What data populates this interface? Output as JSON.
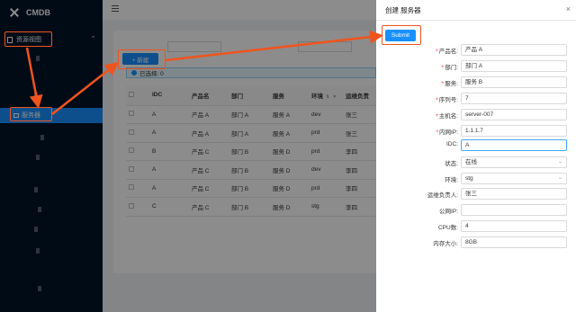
{
  "app": {
    "title": "CMDB"
  },
  "sidebar": {
    "group_label": "资源视图",
    "group_chevron": "^",
    "active_item": "服务器"
  },
  "toolbar": {
    "new_label": "+ 新建"
  },
  "selection": {
    "text": "已选择: 0"
  },
  "table": {
    "headers": [
      "IDC",
      "产品名",
      "部门",
      "服务",
      "环境",
      "运维负责"
    ],
    "rows": [
      [
        "A",
        "产品 A",
        "部门 A",
        "服务 A",
        "dev",
        "张三"
      ],
      [
        "A",
        "产品 A",
        "部门 A",
        "服务 A",
        "prd",
        "张三"
      ],
      [
        "B",
        "产品 C",
        "部门 B",
        "服务 D",
        "prd",
        "李四"
      ],
      [
        "A",
        "产品 C",
        "部门 B",
        "服务 D",
        "dev",
        "李四"
      ],
      [
        "A",
        "产品 C",
        "部门 B",
        "服务 D",
        "prd",
        "李四"
      ],
      [
        "C",
        "产品 C",
        "部门 B",
        "服务 D",
        "stg",
        "李四"
      ]
    ]
  },
  "drawer": {
    "title": "创建 服务器",
    "close": "×",
    "submit_label": "Submit",
    "fields": [
      {
        "label": "产品名:",
        "value": "产品 A",
        "required": true
      },
      {
        "label": "部门:",
        "value": "部门 A",
        "required": true
      },
      {
        "label": "服务:",
        "value": "服务 B",
        "required": true
      },
      {
        "label": "序列号:",
        "value": "7",
        "required": true
      },
      {
        "label": "主机名:",
        "value": "server-007",
        "required": true
      },
      {
        "label": "内网IP:",
        "value": "1.1.1.7",
        "required": true
      },
      {
        "label": "IDC:",
        "value": "A",
        "required": false
      },
      {
        "label": "状态:",
        "value": "在线",
        "required": false
      },
      {
        "label": "环境:",
        "value": "stg",
        "required": false
      },
      {
        "label": "运维负责人:",
        "value": "张三",
        "required": false
      },
      {
        "label": "公网IP:",
        "value": "",
        "required": false
      },
      {
        "label": "CPU数:",
        "value": "4",
        "required": false
      },
      {
        "label": "内存大小:",
        "value": "8GB",
        "required": false
      }
    ]
  },
  "colors": {
    "primary": "#1890ff",
    "sidebar": "#001529",
    "annotation": "#f0541e"
  }
}
